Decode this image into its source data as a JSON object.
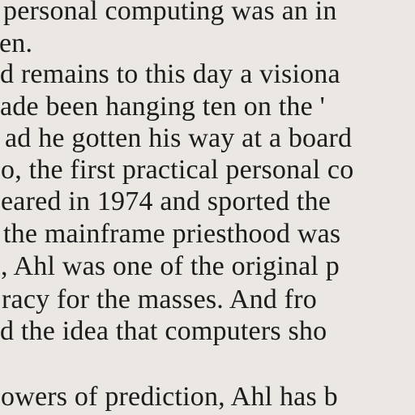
{
  "lines": [
    "personal computing was an in",
    "en.",
    "d remains to this day a visiona",
    "ade been hanging ten on the '",
    "ad he gotten his way at a board",
    "o, the first practical personal co",
    "eared in 1974 and sported the",
    "the mainframe priesthood was",
    ", Ahl was one of the original p",
    "racy for the masses. And fro",
    "d the idea that computers sho",
    "",
    "owers of prediction, Ahl has b"
  ]
}
